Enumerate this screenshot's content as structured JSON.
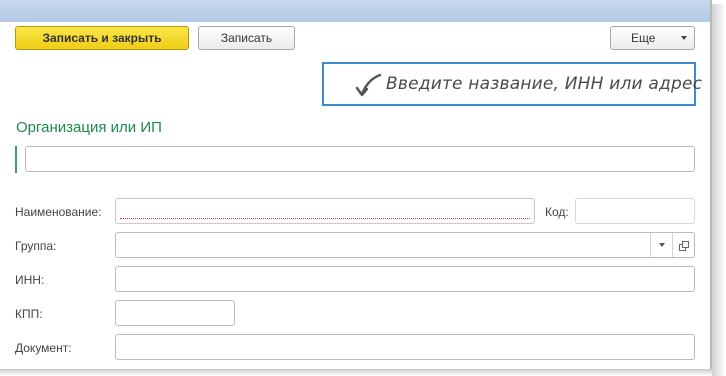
{
  "toolbar": {
    "save_close_label": "Записать и закрыть",
    "save_label": "Записать",
    "more_label": "Еще"
  },
  "hint": {
    "text": "Введите название, ИНН или адрес"
  },
  "section": {
    "title": "Организация или ИП"
  },
  "form": {
    "org_search": {
      "value": ""
    },
    "name": {
      "label": "Наименование:",
      "value": ""
    },
    "code": {
      "label": "Код:",
      "value": ""
    },
    "group": {
      "label": "Группа:",
      "value": ""
    },
    "inn": {
      "label": "ИНН:",
      "value": ""
    },
    "kpp": {
      "label": "КПП:",
      "value": ""
    },
    "document": {
      "label": "Документ:",
      "value": ""
    }
  },
  "colors": {
    "primary_button": "#f0cd17",
    "hint_border": "#3a8dd0",
    "section_title": "#1f8a4c",
    "error_underline": "#dd3333"
  },
  "icons": {
    "hint_arrow": "curved-arrow-icon",
    "dropdown": "chevron-down-icon",
    "open": "open-window-icon"
  }
}
